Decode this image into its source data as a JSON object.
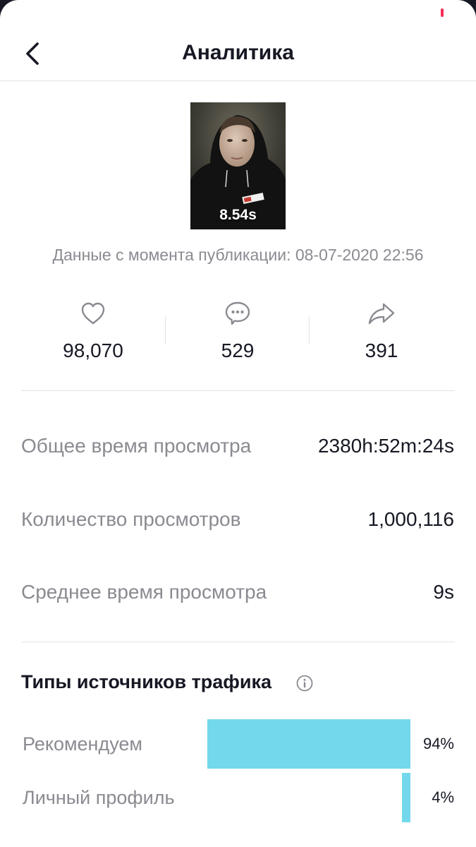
{
  "header": {
    "title": "Аналитика",
    "back_icon": "chevron-left-icon"
  },
  "video": {
    "duration": "8.54s"
  },
  "published": {
    "text": "Данные с момента публикации: 08-07-2020 22:56"
  },
  "engagement": {
    "likes": "98,070",
    "comments": "529",
    "shares": "391",
    "icons": [
      "heart-icon",
      "comment-icon",
      "share-icon"
    ]
  },
  "metrics": [
    {
      "label": "Общее время просмотра",
      "value": "2380h:52m:24s"
    },
    {
      "label": "Количество просмотров",
      "value": "1,000,116"
    },
    {
      "label": "Среднее время просмотра",
      "value": "9s"
    }
  ],
  "traffic": {
    "title": "Типы источников трафика",
    "sources": [
      {
        "label": "Рекомендуем",
        "percent": "94%",
        "share": 0.94
      },
      {
        "label": "Личный профиль",
        "percent": "4%",
        "share": 0.04
      }
    ]
  },
  "colors": {
    "accent": "#74d8ec",
    "text_primary": "#161823",
    "text_secondary": "#8a8b91",
    "divider": "#e3e3e4",
    "status_dot": "#fe2c55"
  }
}
